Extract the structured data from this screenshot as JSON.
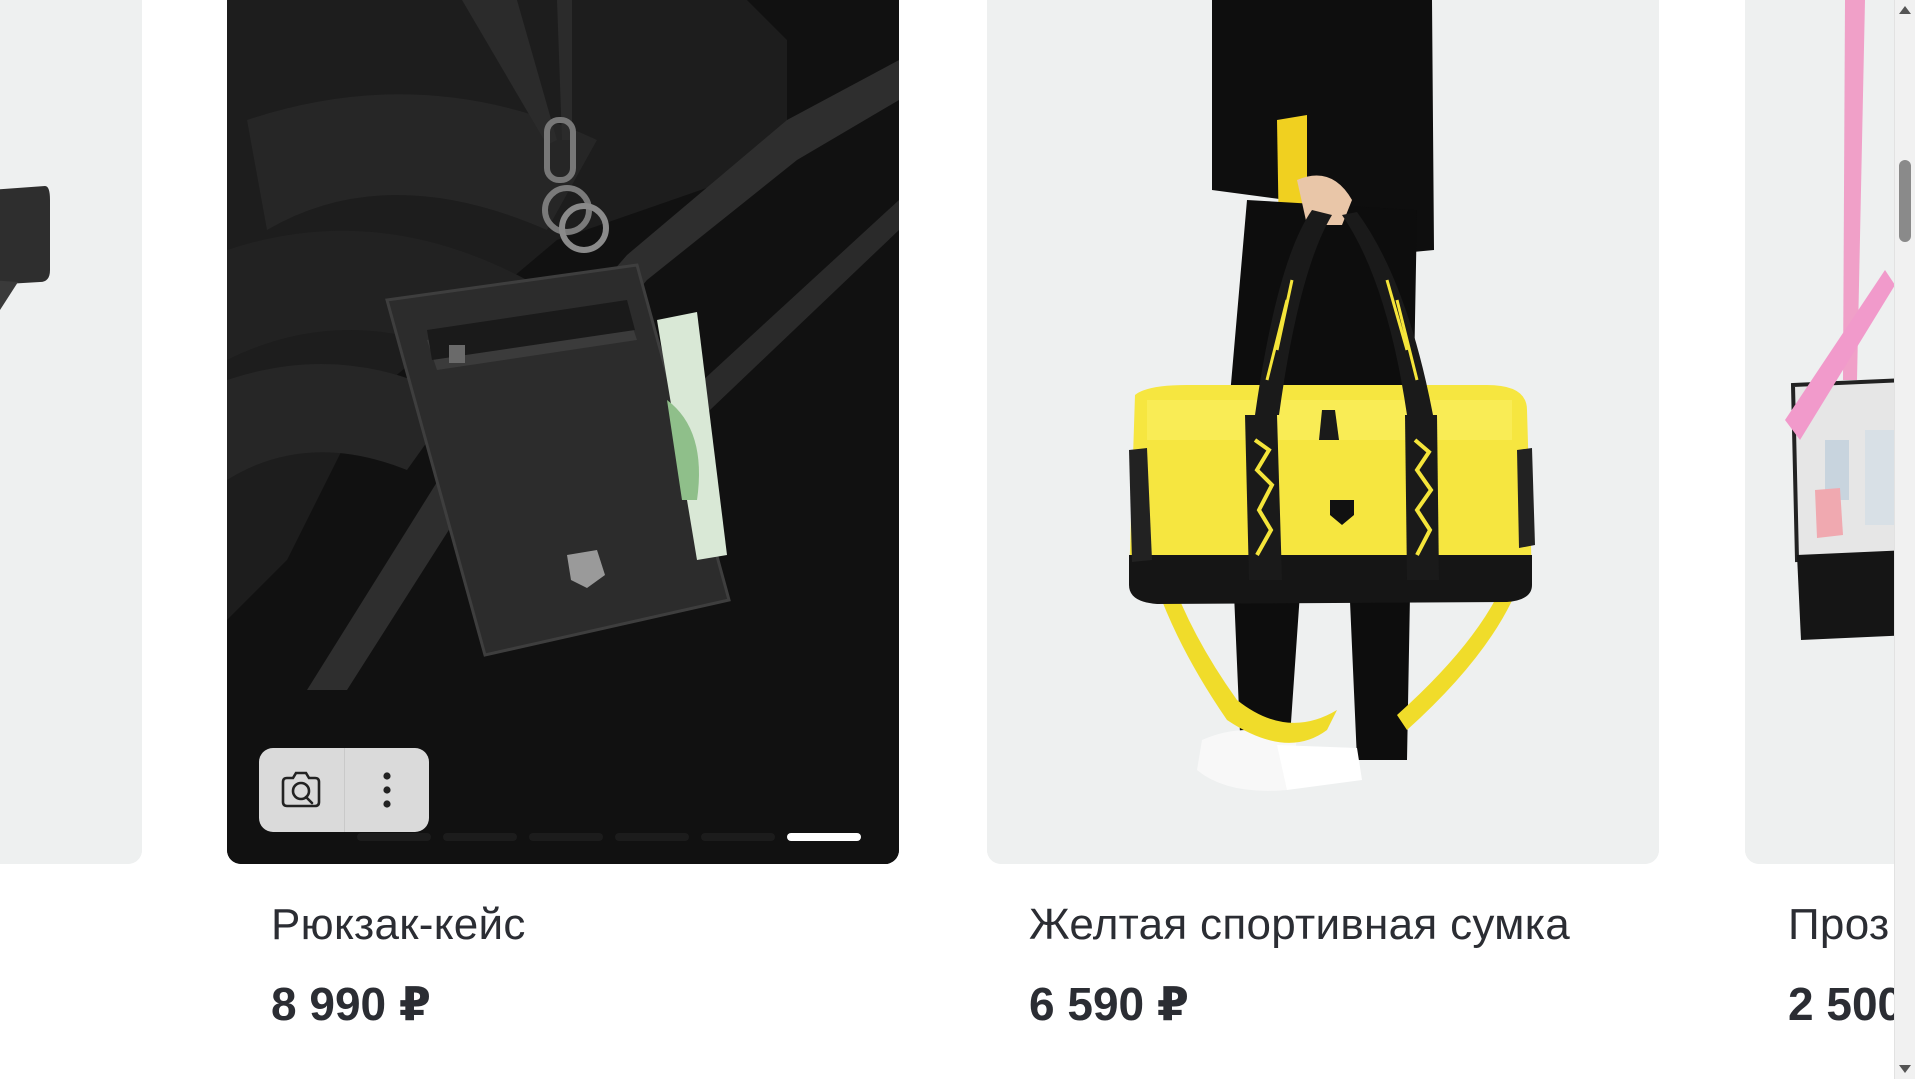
{
  "products": [
    {
      "title": "",
      "price": ""
    },
    {
      "title": "Рюкзак-кейс",
      "price": "8 990 ₽",
      "image_carousel": {
        "total": 6,
        "active_index": 6
      }
    },
    {
      "title": "Желтая спортивная сумка",
      "price": "6 590 ₽"
    },
    {
      "title": "Проз",
      "price": "2 500"
    }
  ],
  "actions": {
    "camera_icon": "camera-search-icon",
    "more_icon": "more-vertical-icon"
  },
  "colors": {
    "text": "#2b2d33",
    "card_bg": "#eef0f0",
    "accent_yellow": "#f5e53a"
  }
}
